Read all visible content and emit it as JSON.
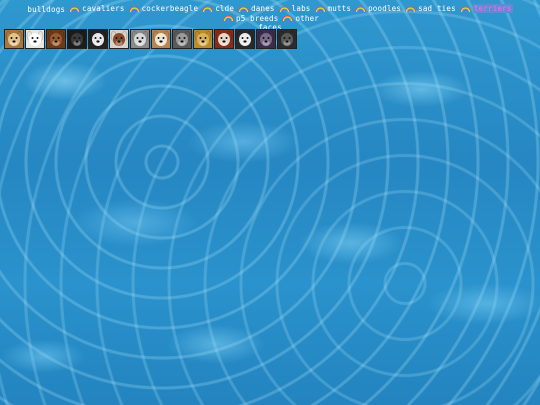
{
  "nav": {
    "items": [
      {
        "label": "bulldogs",
        "active": false
      },
      {
        "label": "cavaliers",
        "active": false
      },
      {
        "label": "cockerbeagle",
        "active": false
      },
      {
        "label": "clde",
        "active": false
      },
      {
        "label": "danes",
        "active": false
      },
      {
        "label": "labs",
        "active": false
      },
      {
        "label": "mutts",
        "active": false
      },
      {
        "label": "poodles",
        "active": false
      },
      {
        "label": "sad ties",
        "active": false
      },
      {
        "label": "terriers",
        "active": true
      },
      {
        "label": "p5 breeds",
        "active": false
      },
      {
        "label": "other",
        "active": false
      },
      {
        "label": "faces",
        "active": false
      }
    ],
    "separator_icon": "rainbow-icon",
    "active_color": "#ff66ff",
    "link_color": "#ffffff"
  },
  "dog_icons": [
    {
      "name": "dog-icon-tan-muzzle",
      "fur": "#a8773f",
      "face": "#e2c48a"
    },
    {
      "name": "dog-icon-white",
      "fur": "#e8e6e0",
      "face": "#ffffff"
    },
    {
      "name": "dog-icon-brown",
      "fur": "#6b3a1a",
      "face": "#9a5a2c"
    },
    {
      "name": "dog-icon-black",
      "fur": "#1c1c1c",
      "face": "#3a3a3a"
    },
    {
      "name": "dog-icon-black-white",
      "fur": "#222222",
      "face": "#e8e8e8"
    },
    {
      "name": "dog-icon-calico",
      "fur": "#d8d4cc",
      "face": "#8a4a2a"
    },
    {
      "name": "dog-icon-grey",
      "fur": "#8a8a8a",
      "face": "#d8d8d8"
    },
    {
      "name": "dog-icon-tan-white",
      "fur": "#b78454",
      "face": "#f0e6d4"
    },
    {
      "name": "dog-icon-grey-dark",
      "fur": "#5a5a5a",
      "face": "#9a9a9a"
    },
    {
      "name": "dog-icon-golden",
      "fur": "#b98a2e",
      "face": "#d8b256"
    },
    {
      "name": "dog-icon-red",
      "fur": "#8a2c1a",
      "face": "#e8d8c8"
    },
    {
      "name": "dog-icon-dark-white",
      "fur": "#2a2a2a",
      "face": "#ececec"
    },
    {
      "name": "dog-icon-purple",
      "fur": "#3a2c4a",
      "face": "#7a6a8a"
    },
    {
      "name": "dog-icon-charcoal",
      "fur": "#2c2c2c",
      "face": "#5a5a5a"
    }
  ],
  "colors": {
    "water": "#2687c2",
    "highlight": "#a0e6ff"
  }
}
